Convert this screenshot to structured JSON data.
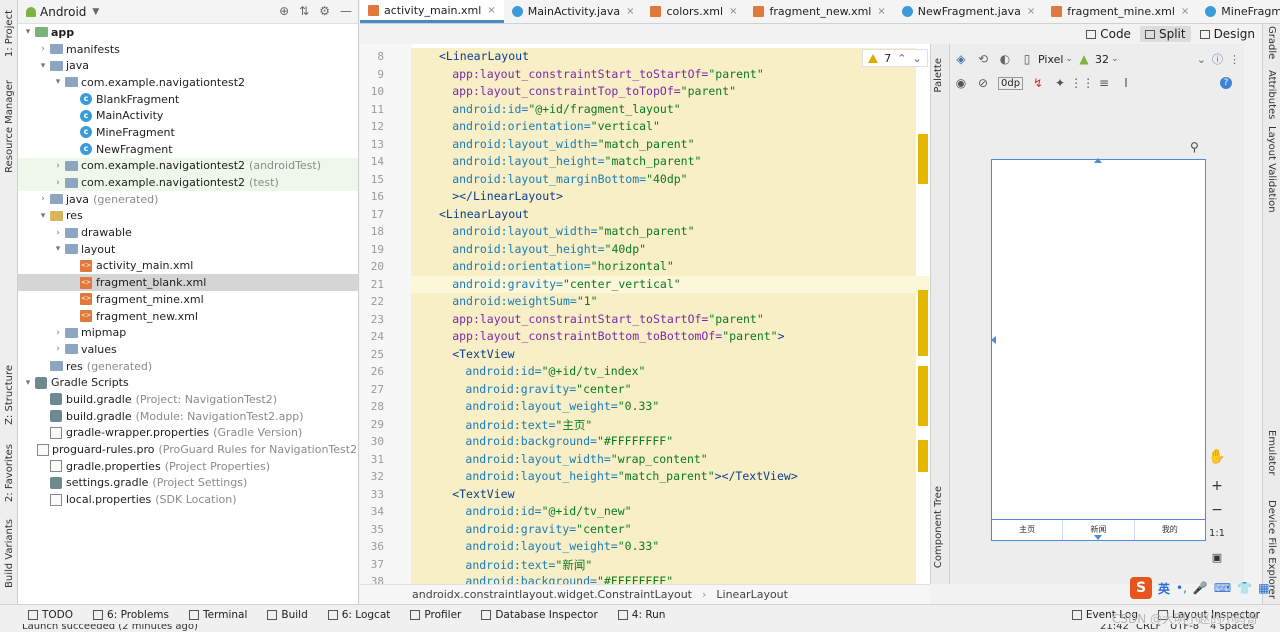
{
  "project_panel": {
    "title": "Android",
    "tree": [
      {
        "label": "app",
        "sub": "",
        "indent": 0,
        "arrow": "▾",
        "icon": "folder-green",
        "bold": true
      },
      {
        "label": "manifests",
        "sub": "",
        "indent": 1,
        "arrow": "›",
        "icon": "folder"
      },
      {
        "label": "java",
        "sub": "",
        "indent": 1,
        "arrow": "▾",
        "icon": "folder"
      },
      {
        "label": "com.example.navigationtest2",
        "sub": "",
        "indent": 2,
        "arrow": "▾",
        "icon": "folder"
      },
      {
        "label": "BlankFragment",
        "sub": "",
        "indent": 3,
        "arrow": "",
        "icon": "class"
      },
      {
        "label": "MainActivity",
        "sub": "",
        "indent": 3,
        "arrow": "",
        "icon": "class"
      },
      {
        "label": "MineFragment",
        "sub": "",
        "indent": 3,
        "arrow": "",
        "icon": "class"
      },
      {
        "label": "NewFragment",
        "sub": "",
        "indent": 3,
        "arrow": "",
        "icon": "class"
      },
      {
        "label": "com.example.navigationtest2",
        "sub": "(androidTest)",
        "indent": 2,
        "arrow": "›",
        "icon": "folder",
        "green": true
      },
      {
        "label": "com.example.navigationtest2",
        "sub": "(test)",
        "indent": 2,
        "arrow": "›",
        "icon": "folder",
        "green": true
      },
      {
        "label": "java",
        "sub": "(generated)",
        "indent": 1,
        "arrow": "›",
        "icon": "folder"
      },
      {
        "label": "res",
        "sub": "",
        "indent": 1,
        "arrow": "▾",
        "icon": "folder-yellow"
      },
      {
        "label": "drawable",
        "sub": "",
        "indent": 2,
        "arrow": "›",
        "icon": "folder"
      },
      {
        "label": "layout",
        "sub": "",
        "indent": 2,
        "arrow": "▾",
        "icon": "folder"
      },
      {
        "label": "activity_main.xml",
        "sub": "",
        "indent": 3,
        "arrow": "",
        "icon": "xml"
      },
      {
        "label": "fragment_blank.xml",
        "sub": "",
        "indent": 3,
        "arrow": "",
        "icon": "xml",
        "selected": true
      },
      {
        "label": "fragment_mine.xml",
        "sub": "",
        "indent": 3,
        "arrow": "",
        "icon": "xml"
      },
      {
        "label": "fragment_new.xml",
        "sub": "",
        "indent": 3,
        "arrow": "",
        "icon": "xml"
      },
      {
        "label": "mipmap",
        "sub": "",
        "indent": 2,
        "arrow": "›",
        "icon": "folder"
      },
      {
        "label": "values",
        "sub": "",
        "indent": 2,
        "arrow": "›",
        "icon": "folder"
      },
      {
        "label": "res",
        "sub": "(generated)",
        "indent": 1,
        "arrow": "",
        "icon": "folder"
      },
      {
        "label": "Gradle Scripts",
        "sub": "",
        "indent": 0,
        "arrow": "▾",
        "icon": "gradle"
      },
      {
        "label": "build.gradle",
        "sub": "(Project: NavigationTest2)",
        "indent": 1,
        "arrow": "",
        "icon": "gradle"
      },
      {
        "label": "build.gradle",
        "sub": "(Module: NavigationTest2.app)",
        "indent": 1,
        "arrow": "",
        "icon": "gradle"
      },
      {
        "label": "gradle-wrapper.properties",
        "sub": "(Gradle Version)",
        "indent": 1,
        "arrow": "",
        "icon": "prop"
      },
      {
        "label": "proguard-rules.pro",
        "sub": "(ProGuard Rules for NavigationTest2.app)",
        "indent": 1,
        "arrow": "",
        "icon": "prop"
      },
      {
        "label": "gradle.properties",
        "sub": "(Project Properties)",
        "indent": 1,
        "arrow": "",
        "icon": "prop"
      },
      {
        "label": "settings.gradle",
        "sub": "(Project Settings)",
        "indent": 1,
        "arrow": "",
        "icon": "gradle"
      },
      {
        "label": "local.properties",
        "sub": "(SDK Location)",
        "indent": 1,
        "arrow": "",
        "icon": "prop"
      }
    ]
  },
  "left_strip": {
    "project": "1: Project",
    "resource_manager": "Resource Manager",
    "structure": "Z: Structure",
    "favorites": "2: Favorites",
    "build_variants": "Build Variants"
  },
  "tabs": [
    {
      "label": "activity_main.xml",
      "icon": "xml",
      "active": true
    },
    {
      "label": "MainActivity.java",
      "icon": "class"
    },
    {
      "label": "colors.xml",
      "icon": "xml"
    },
    {
      "label": "fragment_new.xml",
      "icon": "xml"
    },
    {
      "label": "NewFragment.java",
      "icon": "class"
    },
    {
      "label": "fragment_mine.xml",
      "icon": "xml"
    },
    {
      "label": "MineFragment.java",
      "icon": "class"
    }
  ],
  "view_modes": {
    "code": "Code",
    "split": "Split",
    "design": "Design"
  },
  "editor": {
    "warning_count": "7",
    "lines": [
      {
        "n": "8",
        "indent": 2,
        "parts": [
          [
            "tag",
            "<LinearLayout"
          ]
        ]
      },
      {
        "n": "9",
        "indent": 4,
        "parts": [
          [
            "attr",
            "app:layout_constraintStart_toStartOf="
          ],
          [
            "val",
            "\"parent\""
          ]
        ]
      },
      {
        "n": "10",
        "indent": 4,
        "parts": [
          [
            "attr",
            "app:layout_constraintTop_toTopOf="
          ],
          [
            "val",
            "\"parent\""
          ]
        ]
      },
      {
        "n": "11",
        "indent": 4,
        "parts": [
          [
            "attr2",
            "android:id="
          ],
          [
            "val",
            "\"@+id/fragment_layout\""
          ]
        ]
      },
      {
        "n": "12",
        "indent": 4,
        "parts": [
          [
            "attr2",
            "android:orientation="
          ],
          [
            "val",
            "\"vertical\""
          ]
        ]
      },
      {
        "n": "13",
        "indent": 4,
        "parts": [
          [
            "attr2",
            "android:layout_width="
          ],
          [
            "val",
            "\"match_parent\""
          ]
        ]
      },
      {
        "n": "14",
        "indent": 4,
        "parts": [
          [
            "attr2",
            "android:layout_height="
          ],
          [
            "val",
            "\"match_parent\""
          ]
        ]
      },
      {
        "n": "15",
        "indent": 4,
        "parts": [
          [
            "attr2",
            "android:layout_marginBottom="
          ],
          [
            "val",
            "\"40dp\""
          ]
        ]
      },
      {
        "n": "16",
        "indent": 4,
        "parts": [
          [
            "tag",
            "></LinearLayout>"
          ]
        ]
      },
      {
        "n": "17",
        "indent": 2,
        "parts": [
          [
            "tag",
            "<LinearLayout"
          ]
        ]
      },
      {
        "n": "18",
        "indent": 4,
        "parts": [
          [
            "attr2",
            "android:layout_width="
          ],
          [
            "val",
            "\"match_parent\""
          ]
        ]
      },
      {
        "n": "19",
        "indent": 4,
        "parts": [
          [
            "attr2",
            "android:layout_height="
          ],
          [
            "val",
            "\"40dp\""
          ]
        ]
      },
      {
        "n": "20",
        "indent": 4,
        "parts": [
          [
            "attr2",
            "android:orientation="
          ],
          [
            "val",
            "\"horizontal\""
          ]
        ]
      },
      {
        "n": "21",
        "indent": 4,
        "parts": [
          [
            "attr2",
            "android:gravity="
          ],
          [
            "val",
            "\"center_vertical\""
          ]
        ],
        "current": true
      },
      {
        "n": "22",
        "indent": 4,
        "parts": [
          [
            "attr2",
            "android:weightSum="
          ],
          [
            "val",
            "\"1\""
          ]
        ]
      },
      {
        "n": "23",
        "indent": 4,
        "parts": [
          [
            "attr",
            "app:layout_constraintStart_toStartOf="
          ],
          [
            "val",
            "\"parent\""
          ]
        ]
      },
      {
        "n": "24",
        "indent": 4,
        "parts": [
          [
            "attr",
            "app:layout_constraintBottom_toBottomOf="
          ],
          [
            "val",
            "\"parent\""
          ],
          [
            "tag",
            ">"
          ]
        ]
      },
      {
        "n": "25",
        "indent": 4,
        "parts": [
          [
            "tag",
            "<TextView"
          ]
        ]
      },
      {
        "n": "26",
        "indent": 6,
        "parts": [
          [
            "attr2",
            "android:id="
          ],
          [
            "val",
            "\"@+id/tv_index\""
          ]
        ]
      },
      {
        "n": "27",
        "indent": 6,
        "parts": [
          [
            "attr2",
            "android:gravity="
          ],
          [
            "val",
            "\"center\""
          ]
        ]
      },
      {
        "n": "28",
        "indent": 6,
        "parts": [
          [
            "attr2",
            "android:layout_weight="
          ],
          [
            "val",
            "\"0.33\""
          ]
        ]
      },
      {
        "n": "29",
        "indent": 6,
        "parts": [
          [
            "attr2",
            "android:text="
          ],
          [
            "val",
            "\"主页\""
          ]
        ]
      },
      {
        "n": "30",
        "indent": 6,
        "parts": [
          [
            "attr2",
            "android:background="
          ],
          [
            "val",
            "\"#FFFFFFFF\""
          ]
        ]
      },
      {
        "n": "31",
        "indent": 6,
        "parts": [
          [
            "attr2",
            "android:layout_width="
          ],
          [
            "val",
            "\"wrap_content\""
          ]
        ]
      },
      {
        "n": "32",
        "indent": 6,
        "parts": [
          [
            "attr2",
            "android:layout_height="
          ],
          [
            "val",
            "\"match_parent\""
          ],
          [
            "tag",
            "></TextView>"
          ]
        ]
      },
      {
        "n": "33",
        "indent": 4,
        "parts": [
          [
            "tag",
            "<TextView"
          ]
        ]
      },
      {
        "n": "34",
        "indent": 6,
        "parts": [
          [
            "attr2",
            "android:id="
          ],
          [
            "val",
            "\"@+id/tv_new\""
          ]
        ]
      },
      {
        "n": "35",
        "indent": 6,
        "parts": [
          [
            "attr2",
            "android:gravity="
          ],
          [
            "val",
            "\"center\""
          ]
        ]
      },
      {
        "n": "36",
        "indent": 6,
        "parts": [
          [
            "attr2",
            "android:layout_weight="
          ],
          [
            "val",
            "\"0.33\""
          ]
        ]
      },
      {
        "n": "37",
        "indent": 6,
        "parts": [
          [
            "attr2",
            "android:text="
          ],
          [
            "val",
            "\"新闻\""
          ]
        ]
      },
      {
        "n": "38",
        "indent": 6,
        "parts": [
          [
            "attr2",
            "android:background="
          ],
          [
            "val",
            "\"#FFFFFFFF\""
          ]
        ]
      }
    ]
  },
  "breadcrumb": [
    "androidx.constraintlayout.widget.ConstraintLayout",
    "LinearLayout"
  ],
  "side_tabs": {
    "palette": "Palette",
    "component_tree": "Component Tree"
  },
  "design_toolbar": {
    "device": "Pixel",
    "api": "32",
    "margin": "0dp"
  },
  "phone_preview": {
    "tabs": [
      "主页",
      "新闻",
      "我的"
    ]
  },
  "zoom": {
    "plus": "+",
    "minus": "−",
    "ratio": "1:1"
  },
  "right_strip": {
    "gradle": "Gradle",
    "attributes": "Attributes",
    "layout_validation": "Layout Validation",
    "emulator": "Emulator",
    "device_file_explorer": "Device File Explorer"
  },
  "bottom_tools": [
    {
      "label": "TODO"
    },
    {
      "label": "6: Problems"
    },
    {
      "label": "Terminal"
    },
    {
      "label": "Build"
    },
    {
      "label": "6: Logcat"
    },
    {
      "label": "Profiler"
    },
    {
      "label": "Database Inspector"
    },
    {
      "label": "4: Run"
    }
  ],
  "bottom_right_tools": [
    {
      "label": "Event Log"
    },
    {
      "label": "Layout Inspector"
    }
  ],
  "status": {
    "message": "Launch succeeded (2 minutes ago)",
    "position": "21:42",
    "line_sep": "CRLF",
    "encoding": "UTF-8",
    "indent": "4 spaces"
  },
  "ime": {
    "lang": "英"
  },
  "watermark": "CSDN @大明小赵的小码哥",
  "colors": {
    "accent": "#4a88c7",
    "highlight": "#f8efc7",
    "marker": "#e5b800"
  }
}
